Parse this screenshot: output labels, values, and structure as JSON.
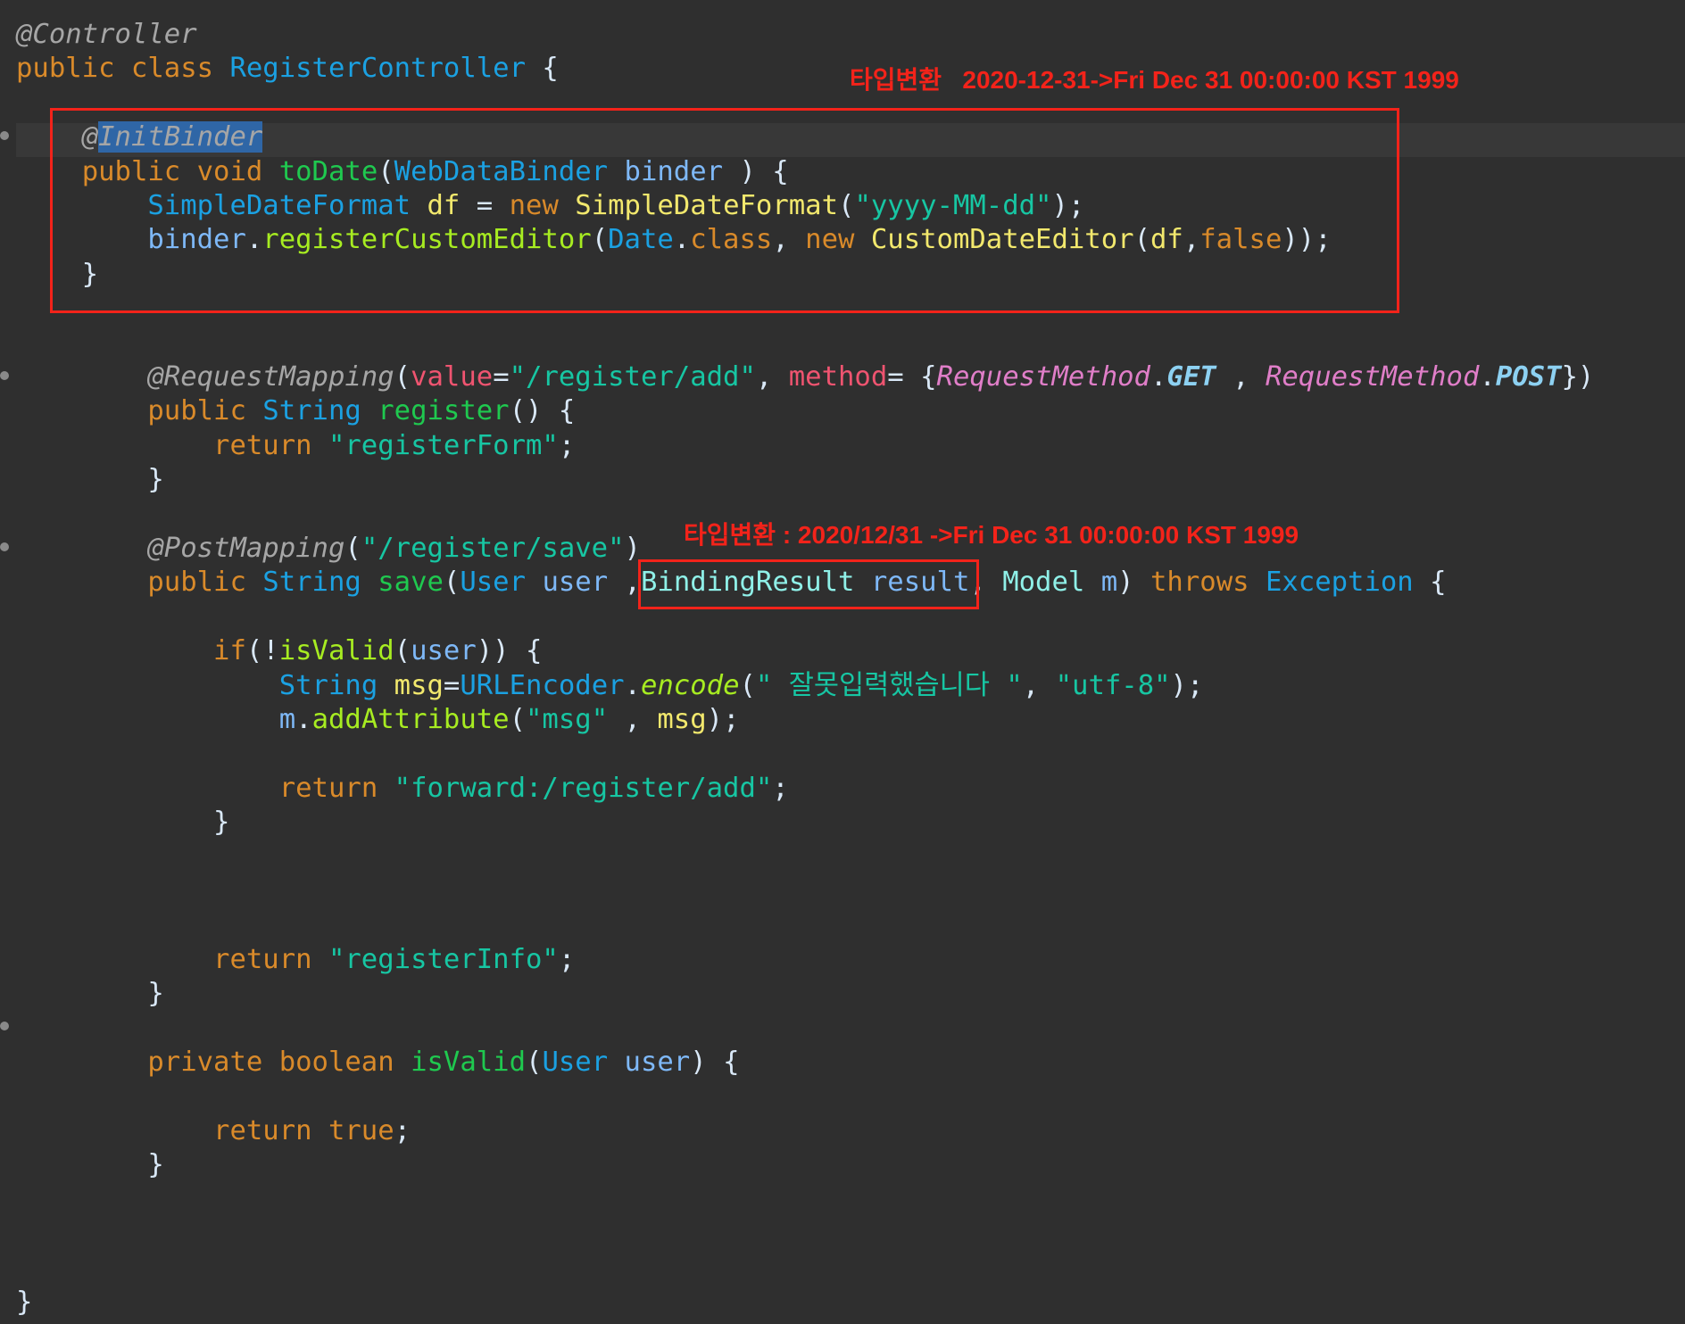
{
  "colors": {
    "background": "#2f2f2f",
    "annotation": "#f3231a",
    "highlight": "#2f66a6"
  },
  "code": {
    "lines": [
      [
        {
          "t": "@Controller",
          "c": "#a6a6a6",
          "i": true
        }
      ],
      [
        {
          "t": "public class ",
          "c": "#d98a2a"
        },
        {
          "t": "RegisterController",
          "c": "#1ba1e2"
        },
        {
          "t": " {",
          "c": "#d9e8f7"
        }
      ],
      [],
      [
        {
          "t": "    ",
          "c": "#d9e8f7"
        },
        {
          "t": "@",
          "c": "#a6a6a6",
          "i": true
        },
        {
          "t": "InitBinder",
          "c": "#a6a6a6",
          "i": true,
          "hl": true
        }
      ],
      [
        {
          "t": "    ",
          "c": "#d9e8f7"
        },
        {
          "t": "public void ",
          "c": "#d98a2a"
        },
        {
          "t": "toDate",
          "c": "#1fc94f"
        },
        {
          "t": "(",
          "c": "#d9e8f7"
        },
        {
          "t": "WebDataBinder",
          "c": "#1ba1e2"
        },
        {
          "t": " ",
          "c": "#d9e8f7"
        },
        {
          "t": "binder",
          "c": "#7eb8f7"
        },
        {
          "t": " ) {",
          "c": "#d9e8f7"
        }
      ],
      [
        {
          "t": "        ",
          "c": "#d9e8f7"
        },
        {
          "t": "SimpleDateFormat",
          "c": "#1ba1e2"
        },
        {
          "t": " ",
          "c": "#d9e8f7"
        },
        {
          "t": "df",
          "c": "#f2e86d"
        },
        {
          "t": " = ",
          "c": "#d9e8f7"
        },
        {
          "t": "new ",
          "c": "#d98a2a"
        },
        {
          "t": "SimpleDateFormat",
          "c": "#f2e86d"
        },
        {
          "t": "(",
          "c": "#d9e8f7"
        },
        {
          "t": "\"yyyy-MM-dd\"",
          "c": "#17c6a3"
        },
        {
          "t": ");",
          "c": "#d9e8f7"
        }
      ],
      [
        {
          "t": "        ",
          "c": "#d9e8f7"
        },
        {
          "t": "binder",
          "c": "#7eb8f7"
        },
        {
          "t": ".",
          "c": "#d9e8f7"
        },
        {
          "t": "registerCustomEditor",
          "c": "#a7ec21"
        },
        {
          "t": "(",
          "c": "#d9e8f7"
        },
        {
          "t": "Date",
          "c": "#1ba1e2"
        },
        {
          "t": ".",
          "c": "#d9e8f7"
        },
        {
          "t": "class",
          "c": "#d98a2a"
        },
        {
          "t": ", ",
          "c": "#d9e8f7"
        },
        {
          "t": "new ",
          "c": "#d98a2a"
        },
        {
          "t": "CustomDateEditor",
          "c": "#f2e86d"
        },
        {
          "t": "(",
          "c": "#d9e8f7"
        },
        {
          "t": "df",
          "c": "#f2e86d"
        },
        {
          "t": ",",
          "c": "#d9e8f7"
        },
        {
          "t": "false",
          "c": "#d98a2a"
        },
        {
          "t": "));",
          "c": "#d9e8f7"
        }
      ],
      [
        {
          "t": "    }",
          "c": "#d9e8f7"
        }
      ],
      [],
      [],
      [
        {
          "t": "        ",
          "c": "#d9e8f7"
        },
        {
          "t": "@RequestMapping",
          "c": "#a6a6a6",
          "i": true
        },
        {
          "t": "(",
          "c": "#d9e8f7"
        },
        {
          "t": "value",
          "c": "#ef5470"
        },
        {
          "t": "=",
          "c": "#d9e8f7"
        },
        {
          "t": "\"/register/add\"",
          "c": "#17c6a3"
        },
        {
          "t": ", ",
          "c": "#d9e8f7"
        },
        {
          "t": "method",
          "c": "#ef5470"
        },
        {
          "t": "= {",
          "c": "#d9e8f7"
        },
        {
          "t": "RequestMethod",
          "c": "#e07ec8",
          "i": true
        },
        {
          "t": ".",
          "c": "#d9e8f7"
        },
        {
          "t": "GET",
          "c": "#8dd1f2",
          "i": true,
          "b": true
        },
        {
          "t": " , ",
          "c": "#d9e8f7"
        },
        {
          "t": "RequestMethod",
          "c": "#e07ec8",
          "i": true
        },
        {
          "t": ".",
          "c": "#d9e8f7"
        },
        {
          "t": "POST",
          "c": "#8dd1f2",
          "i": true,
          "b": true
        },
        {
          "t": "})",
          "c": "#d9e8f7"
        }
      ],
      [
        {
          "t": "        ",
          "c": "#d9e8f7"
        },
        {
          "t": "public ",
          "c": "#d98a2a"
        },
        {
          "t": "String",
          "c": "#1ba1e2"
        },
        {
          "t": " ",
          "c": "#d9e8f7"
        },
        {
          "t": "register",
          "c": "#1fc94f"
        },
        {
          "t": "() {",
          "c": "#d9e8f7"
        }
      ],
      [
        {
          "t": "            ",
          "c": "#d9e8f7"
        },
        {
          "t": "return ",
          "c": "#d98a2a"
        },
        {
          "t": "\"registerForm\"",
          "c": "#17c6a3"
        },
        {
          "t": ";",
          "c": "#d9e8f7"
        }
      ],
      [
        {
          "t": "        }",
          "c": "#d9e8f7"
        }
      ],
      [],
      [
        {
          "t": "        ",
          "c": "#d9e8f7"
        },
        {
          "t": "@PostMapping",
          "c": "#a6a6a6",
          "i": true
        },
        {
          "t": "(",
          "c": "#d9e8f7"
        },
        {
          "t": "\"/register/save\"",
          "c": "#17c6a3"
        },
        {
          "t": ")",
          "c": "#d9e8f7"
        }
      ],
      [
        {
          "t": "        ",
          "c": "#d9e8f7"
        },
        {
          "t": "public ",
          "c": "#d98a2a"
        },
        {
          "t": "String",
          "c": "#1ba1e2"
        },
        {
          "t": " ",
          "c": "#d9e8f7"
        },
        {
          "t": "save",
          "c": "#1fc94f"
        },
        {
          "t": "(",
          "c": "#d9e8f7"
        },
        {
          "t": "User",
          "c": "#1ba1e2"
        },
        {
          "t": " ",
          "c": "#d9e8f7"
        },
        {
          "t": "user",
          "c": "#7eb8f7"
        },
        {
          "t": " ,",
          "c": "#d9e8f7"
        },
        {
          "t": "BindingResult",
          "c": "#8ff0e8"
        },
        {
          "t": " ",
          "c": "#d9e8f7"
        },
        {
          "t": "result",
          "c": "#7eb8f7"
        },
        {
          "t": ", ",
          "c": "#d9e8f7"
        },
        {
          "t": "Model",
          "c": "#8ff0e8"
        },
        {
          "t": " ",
          "c": "#d9e8f7"
        },
        {
          "t": "m",
          "c": "#7eb8f7"
        },
        {
          "t": ") ",
          "c": "#d9e8f7"
        },
        {
          "t": "throws ",
          "c": "#d98a2a"
        },
        {
          "t": "Exception",
          "c": "#1ba1e2"
        },
        {
          "t": " {",
          "c": "#d9e8f7"
        }
      ],
      [],
      [
        {
          "t": "            ",
          "c": "#d9e8f7"
        },
        {
          "t": "if",
          "c": "#d98a2a"
        },
        {
          "t": "(!",
          "c": "#d9e8f7"
        },
        {
          "t": "isValid",
          "c": "#a7ec21"
        },
        {
          "t": "(",
          "c": "#d9e8f7"
        },
        {
          "t": "user",
          "c": "#7eb8f7"
        },
        {
          "t": ")) {",
          "c": "#d9e8f7"
        }
      ],
      [
        {
          "t": "                ",
          "c": "#d9e8f7"
        },
        {
          "t": "String",
          "c": "#1ba1e2"
        },
        {
          "t": " ",
          "c": "#d9e8f7"
        },
        {
          "t": "msg",
          "c": "#f2e86d"
        },
        {
          "t": "=",
          "c": "#d9e8f7"
        },
        {
          "t": "URLEncoder",
          "c": "#1ba1e2"
        },
        {
          "t": ".",
          "c": "#d9e8f7"
        },
        {
          "t": "encode",
          "c": "#a7ec21",
          "i": true
        },
        {
          "t": "(",
          "c": "#d9e8f7"
        },
        {
          "t": "\" 잘못입력했습니다 \"",
          "c": "#17c6a3"
        },
        {
          "t": ", ",
          "c": "#d9e8f7"
        },
        {
          "t": "\"utf-8\"",
          "c": "#17c6a3"
        },
        {
          "t": ");",
          "c": "#d9e8f7"
        }
      ],
      [
        {
          "t": "                ",
          "c": "#d9e8f7"
        },
        {
          "t": "m",
          "c": "#7eb8f7"
        },
        {
          "t": ".",
          "c": "#d9e8f7"
        },
        {
          "t": "addAttribute",
          "c": "#a7ec21"
        },
        {
          "t": "(",
          "c": "#d9e8f7"
        },
        {
          "t": "\"msg\"",
          "c": "#17c6a3"
        },
        {
          "t": " , ",
          "c": "#d9e8f7"
        },
        {
          "t": "msg",
          "c": "#f2e86d"
        },
        {
          "t": ");",
          "c": "#d9e8f7"
        }
      ],
      [],
      [
        {
          "t": "                ",
          "c": "#d9e8f7"
        },
        {
          "t": "return ",
          "c": "#d98a2a"
        },
        {
          "t": "\"forward:/register/add\"",
          "c": "#17c6a3"
        },
        {
          "t": ";",
          "c": "#d9e8f7"
        }
      ],
      [
        {
          "t": "            }",
          "c": "#d9e8f7"
        }
      ],
      [],
      [],
      [],
      [
        {
          "t": "            ",
          "c": "#d9e8f7"
        },
        {
          "t": "return ",
          "c": "#d98a2a"
        },
        {
          "t": "\"registerInfo\"",
          "c": "#17c6a3"
        },
        {
          "t": ";",
          "c": "#d9e8f7"
        }
      ],
      [
        {
          "t": "        }",
          "c": "#d9e8f7"
        }
      ],
      [],
      [
        {
          "t": "        ",
          "c": "#d9e8f7"
        },
        {
          "t": "private boolean ",
          "c": "#d98a2a"
        },
        {
          "t": "isValid",
          "c": "#1fc94f"
        },
        {
          "t": "(",
          "c": "#d9e8f7"
        },
        {
          "t": "User",
          "c": "#1ba1e2"
        },
        {
          "t": " ",
          "c": "#d9e8f7"
        },
        {
          "t": "user",
          "c": "#7eb8f7"
        },
        {
          "t": ") {",
          "c": "#d9e8f7"
        }
      ],
      [],
      [
        {
          "t": "            ",
          "c": "#d9e8f7"
        },
        {
          "t": "return true",
          "c": "#d98a2a"
        },
        {
          "t": ";",
          "c": "#d9e8f7"
        }
      ],
      [
        {
          "t": "        }",
          "c": "#d9e8f7"
        }
      ],
      [],
      [],
      [],
      [
        {
          "t": "}",
          "c": "#d9e8f7"
        }
      ]
    ]
  },
  "annotations": {
    "note1": "타입변환   2020-12-31->Fri Dec 31 00:00:00 KST 1999",
    "note2": "타입변환 : 2020/12/31 ->Fri Dec 31 00:00:00 KST 1999"
  }
}
